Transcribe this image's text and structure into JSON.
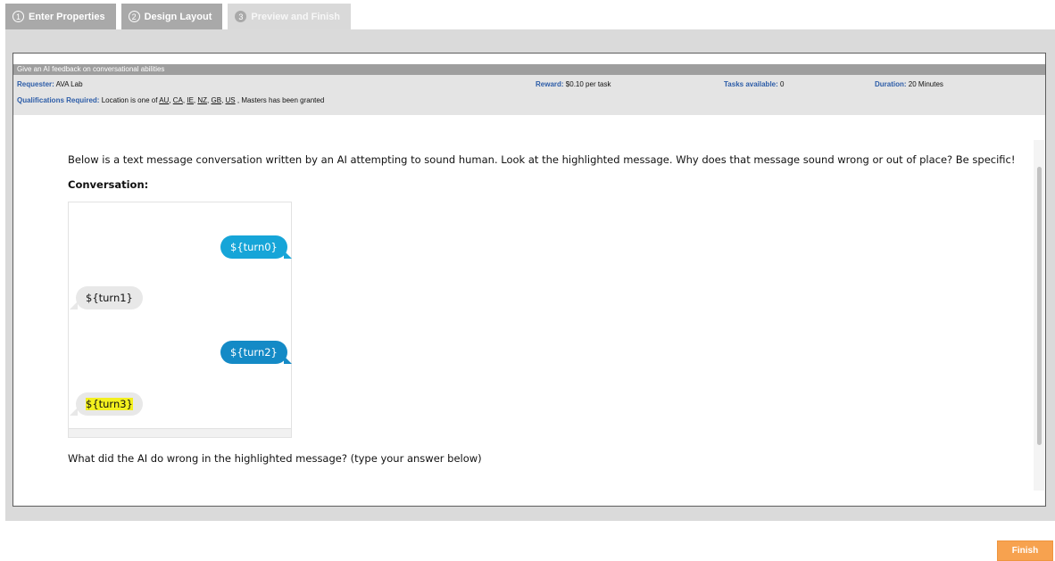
{
  "wizard": {
    "steps": [
      {
        "number": "1",
        "label": "Enter Properties"
      },
      {
        "number": "2",
        "label": "Design Layout"
      },
      {
        "number": "3",
        "label": "Preview and Finish"
      }
    ]
  },
  "hit": {
    "title": "Give an AI feedback on conversational abilities",
    "requester_label": "Requester:",
    "requester": "AVA Lab",
    "reward_label": "Reward:",
    "reward": "$0.10 per task",
    "tasks_label": "Tasks available:",
    "tasks": "0",
    "duration_label": "Duration:",
    "duration": "20 Minutes",
    "qualifications_label": "Qualifications Required:",
    "qualifications_prefix": "Location is one of",
    "locations": [
      "AU",
      "CA",
      "IE",
      "NZ",
      "GB",
      "US"
    ],
    "qualifications_suffix": ", Masters has been granted"
  },
  "task": {
    "instructions": "Below is a text message conversation written by an AI attempting to sound human. Look at the highlighted message. Why does that message sound wrong or out of place? Be specific!",
    "conversation_heading": "Conversation:",
    "messages": [
      "${turn0}",
      "${turn1}",
      "${turn2}",
      "${turn3}"
    ],
    "question": "What did the AI do wrong in the highlighted message? (type your answer below)"
  },
  "actions": {
    "finish_label": "Finish"
  },
  "colors": {
    "sent_bubble": "#16a5d8",
    "sent_bubble_alt": "#148ac6",
    "received_bubble": "#e8e8e8",
    "highlight": "#f3f01f",
    "finish_button": "#f7a24f",
    "label_blue": "#2d5da8"
  }
}
